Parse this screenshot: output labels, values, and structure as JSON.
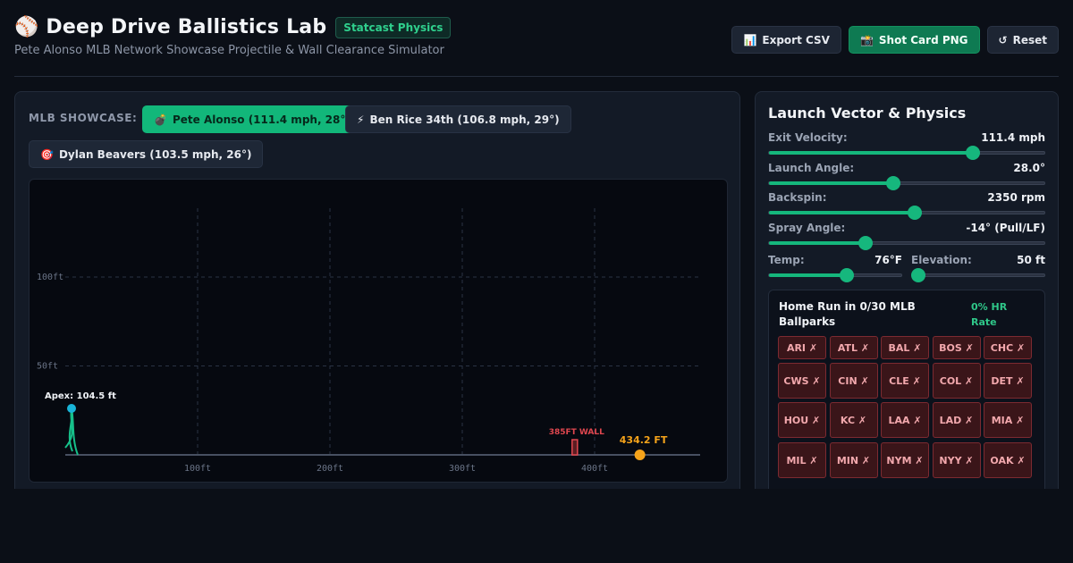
{
  "header": {
    "logo_icon": "⚾",
    "title": "Deep Drive Ballistics Lab",
    "badge": "Statcast Physics",
    "subtitle": "Pete Alonso MLB Network Showcase Projectile & Wall Clearance Simulator",
    "buttons": [
      {
        "icon": "📊",
        "label": "Export CSV"
      },
      {
        "icon": "📸",
        "label": "Shot Card PNG"
      },
      {
        "icon": "↺",
        "label": "Reset"
      }
    ]
  },
  "showcase": {
    "label": "MLB SHOWCASE:",
    "presets": [
      {
        "icon": "💣",
        "label": "Pete Alonso (111.4 mph, 28°)",
        "active": true
      },
      {
        "icon": "⚡",
        "label": "Ben Rice 34th (106.8 mph, 29°)",
        "active": false
      },
      {
        "icon": "🎯",
        "label": "Dylan Beavers (103.5 mph, 26°)",
        "active": false
      }
    ]
  },
  "chart_data": {
    "type": "line",
    "xlabel": "",
    "ylabel": "",
    "x_ticks": [
      "100ft",
      "200ft",
      "300ft",
      "400ft"
    ],
    "y_ticks": [
      "50ft",
      "100ft"
    ],
    "apex_label": "Apex: 104.5 ft",
    "apex_ft": 104.5,
    "wall_label": "385FT WALL",
    "wall_distance_ft": 385,
    "landing_label": "434.2 FT",
    "landing_distance_ft": 434.2,
    "colors": {
      "trajectory": "#16c08a",
      "apex": "#18b4d8",
      "wall": "#e0474f",
      "landing": "#f5a31a"
    }
  },
  "physics": {
    "title": "Launch Vector & Physics",
    "sliders": [
      {
        "label": "Exit Velocity:",
        "value": "111.4 mph",
        "fraction": 0.74
      },
      {
        "label": "Launch Angle:",
        "value": "28.0°",
        "fraction": 0.45
      },
      {
        "label": "Backspin:",
        "value": "2350 rpm",
        "fraction": 0.53
      },
      {
        "label": "Spray Angle:",
        "value": "-14° (Pull/LF)",
        "fraction": 0.35
      }
    ],
    "small_sliders": [
      {
        "label": "Temp:",
        "value": "76°F",
        "fraction": 0.59
      },
      {
        "label": "Elevation:",
        "value": "50 ft",
        "fraction": 0.05
      }
    ]
  },
  "ballparks": {
    "title": "Home Run in 0/30 MLB Ballparks",
    "rate": "0% HR Rate",
    "parks": [
      "ARI ✗",
      "ATL ✗",
      "BAL ✗",
      "BOS ✗",
      "CHC ✗",
      "CWS ✗",
      "CIN ✗",
      "CLE ✗",
      "COL ✗",
      "DET ✗",
      "HOU ✗",
      "KC ✗",
      "LAA ✗",
      "LAD ✗",
      "MIA ✗",
      "MIL ✗",
      "MIN ✗",
      "NYM ✗",
      "NYY ✗",
      "OAK ✗"
    ]
  }
}
